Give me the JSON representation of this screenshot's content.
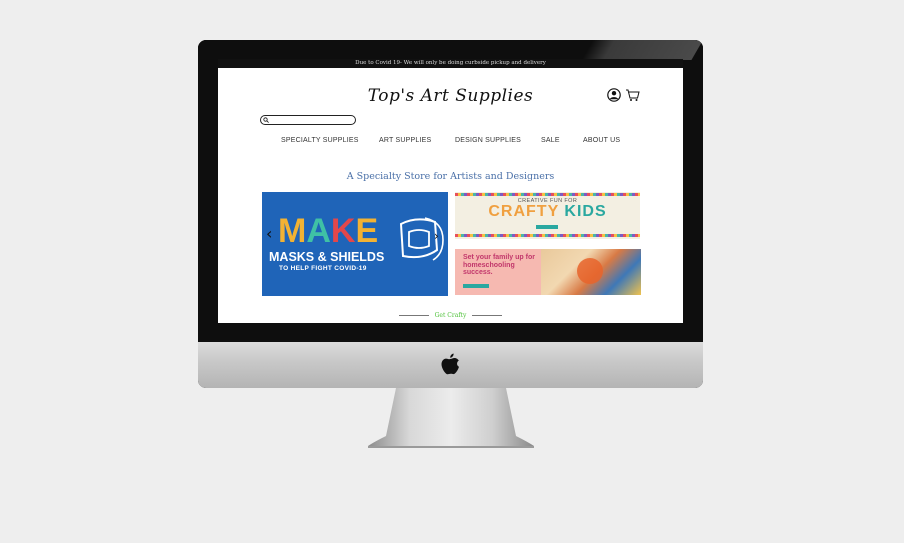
{
  "announcement": "Due to Covid 19- We will only be doing curbside pickup and delivery",
  "logo": "Top's Art Supplies",
  "search": {
    "placeholder": ""
  },
  "nav": [
    "SPECIALTY SUPPLIES",
    "ART SUPPLIES",
    "DESIGN SUPPLIES",
    "SALE",
    "ABOUT US"
  ],
  "tagline": "A Specialty Store for Artists and Designers",
  "banner_make": {
    "letters": [
      "M",
      "A",
      "K",
      "E"
    ],
    "letter_colors": [
      "#f2b233",
      "#3fc1a5",
      "#e2474b",
      "#f2b233"
    ],
    "line1": "MASKS & SHIELDS",
    "line2": "TO HELP FIGHT COVID-19",
    "prev_arrow": "‹",
    "next_arrow": "›"
  },
  "banner_crafty": {
    "top": "CREATIVE FUN FOR",
    "title_a": "CRAFTY",
    "title_b": "KIDS"
  },
  "banner_home": {
    "text": "Set your family up for homeschooling success."
  },
  "footer_label": "Get Crafty",
  "icons": [
    "user-icon",
    "cart-icon",
    "search-icon",
    "apple-logo-icon"
  ],
  "colors": {
    "nav_text": "#333333",
    "tagline": "#4a70a8",
    "make_bg": "#1f64b8",
    "footer_label": "#4fc23a"
  }
}
